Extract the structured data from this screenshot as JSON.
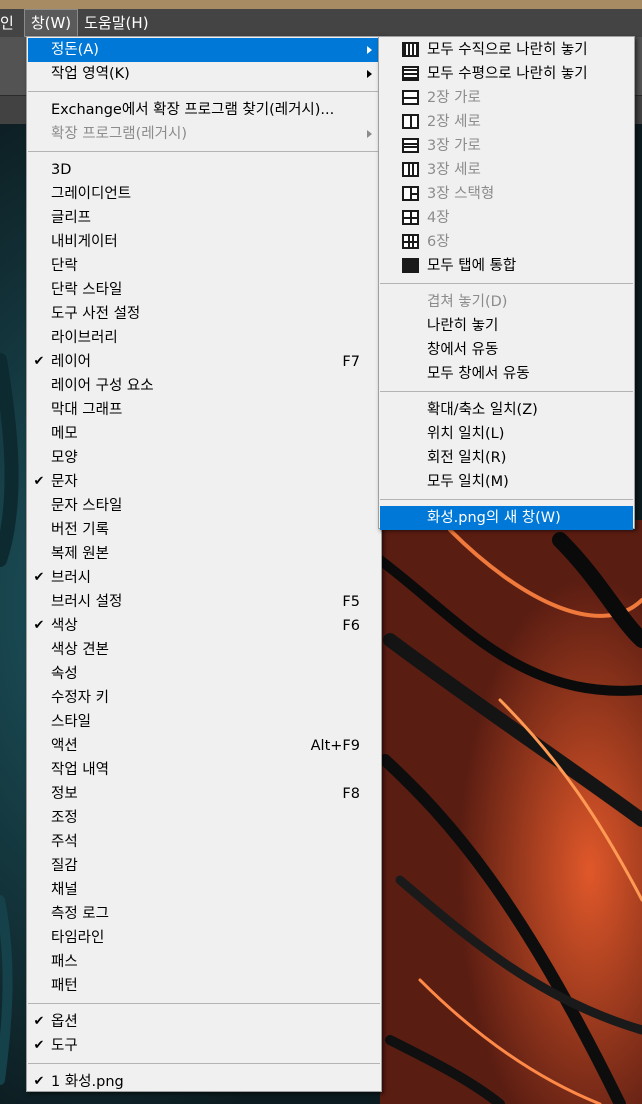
{
  "menubar": {
    "items": [
      {
        "label": "인",
        "partial": true
      },
      {
        "label": "창(W)",
        "active": true
      },
      {
        "label": "도움말(H)"
      }
    ]
  },
  "window_menu": {
    "sections": [
      [
        {
          "label": "정돈(A)",
          "submenu": true,
          "highlighted": true
        },
        {
          "label": "작업 영역(K)",
          "submenu": true
        }
      ],
      [
        {
          "label": "Exchange에서 확장 프로그램 찾기(레거시)..."
        },
        {
          "label": "확장 프로그램(레거시)",
          "submenu": true,
          "disabled": true
        }
      ],
      [
        {
          "label": "3D"
        },
        {
          "label": "그레이디언트"
        },
        {
          "label": "글리프"
        },
        {
          "label": "내비게이터"
        },
        {
          "label": "단락"
        },
        {
          "label": "단락 스타일"
        },
        {
          "label": "도구 사전 설정"
        },
        {
          "label": "라이브러리"
        },
        {
          "label": "레이어",
          "checked": true,
          "shortcut": "F7"
        },
        {
          "label": "레이어 구성 요소"
        },
        {
          "label": "막대 그래프"
        },
        {
          "label": "메모"
        },
        {
          "label": "모양"
        },
        {
          "label": "문자",
          "checked": true
        },
        {
          "label": "문자 스타일"
        },
        {
          "label": "버전 기록"
        },
        {
          "label": "복제 원본"
        },
        {
          "label": "브러시",
          "checked": true
        },
        {
          "label": "브러시 설정",
          "shortcut": "F5"
        },
        {
          "label": "색상",
          "checked": true,
          "shortcut": "F6"
        },
        {
          "label": "색상 견본"
        },
        {
          "label": "속성"
        },
        {
          "label": "수정자 키"
        },
        {
          "label": "스타일"
        },
        {
          "label": "액션",
          "shortcut": "Alt+F9"
        },
        {
          "label": "작업 내역"
        },
        {
          "label": "정보",
          "shortcut": "F8"
        },
        {
          "label": "조정"
        },
        {
          "label": "주석"
        },
        {
          "label": "질감"
        },
        {
          "label": "채널"
        },
        {
          "label": "측정 로그"
        },
        {
          "label": "타임라인"
        },
        {
          "label": "패스"
        },
        {
          "label": "패턴"
        }
      ],
      [
        {
          "label": "옵션",
          "checked": true
        },
        {
          "label": "도구",
          "checked": true
        }
      ],
      [
        {
          "label": "1 화성.png",
          "checked": true
        }
      ]
    ]
  },
  "arrange_submenu": {
    "sections": [
      [
        {
          "label": "모두 수직으로 나란히 놓기",
          "icon": "v4"
        },
        {
          "label": "모두 수평으로 나란히 놓기",
          "icon": "h4"
        },
        {
          "label": "2장 가로",
          "icon": "h2",
          "disabled": true
        },
        {
          "label": "2장 세로",
          "icon": "v2",
          "disabled": true
        },
        {
          "label": "3장 가로",
          "icon": "h3",
          "disabled": true
        },
        {
          "label": "3장 세로",
          "icon": "v3",
          "disabled": true
        },
        {
          "label": "3장 스택형",
          "icon": "s3",
          "disabled": true
        },
        {
          "label": "4장",
          "icon": "g4",
          "disabled": true
        },
        {
          "label": "6장",
          "icon": "g6",
          "disabled": true
        },
        {
          "label": "모두 탭에 통합",
          "icon": "full"
        }
      ],
      [
        {
          "label": "겹쳐 놓기(D)",
          "disabled": true
        },
        {
          "label": "나란히 놓기"
        },
        {
          "label": "창에서 유동"
        },
        {
          "label": "모두 창에서 유동"
        }
      ],
      [
        {
          "label": "확대/축소 일치(Z)"
        },
        {
          "label": "위치 일치(L)"
        },
        {
          "label": "회전 일치(R)"
        },
        {
          "label": "모두 일치(M)"
        }
      ],
      [
        {
          "label": "화성.png의 새 창(W)",
          "highlighted": true
        }
      ]
    ]
  },
  "colors": {
    "highlight": "#0078d7",
    "menu_bg": "#f0f0f0",
    "disabled_text": "#8c8c8c",
    "menubar_bg": "#444444",
    "top_strip": "#a68b63"
  }
}
